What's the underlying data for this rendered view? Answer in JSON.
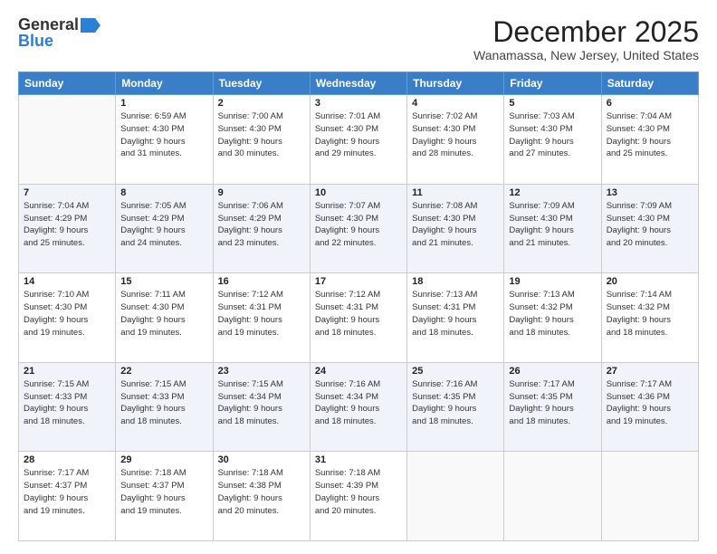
{
  "header": {
    "logo_general": "General",
    "logo_blue": "Blue",
    "title": "December 2025",
    "location": "Wanamassa, New Jersey, United States"
  },
  "days_of_week": [
    "Sunday",
    "Monday",
    "Tuesday",
    "Wednesday",
    "Thursday",
    "Friday",
    "Saturday"
  ],
  "weeks": [
    [
      {
        "day": "",
        "info": ""
      },
      {
        "day": "1",
        "info": "Sunrise: 6:59 AM\nSunset: 4:30 PM\nDaylight: 9 hours\nand 31 minutes."
      },
      {
        "day": "2",
        "info": "Sunrise: 7:00 AM\nSunset: 4:30 PM\nDaylight: 9 hours\nand 30 minutes."
      },
      {
        "day": "3",
        "info": "Sunrise: 7:01 AM\nSunset: 4:30 PM\nDaylight: 9 hours\nand 29 minutes."
      },
      {
        "day": "4",
        "info": "Sunrise: 7:02 AM\nSunset: 4:30 PM\nDaylight: 9 hours\nand 28 minutes."
      },
      {
        "day": "5",
        "info": "Sunrise: 7:03 AM\nSunset: 4:30 PM\nDaylight: 9 hours\nand 27 minutes."
      },
      {
        "day": "6",
        "info": "Sunrise: 7:04 AM\nSunset: 4:30 PM\nDaylight: 9 hours\nand 25 minutes."
      }
    ],
    [
      {
        "day": "7",
        "info": "Sunrise: 7:04 AM\nSunset: 4:29 PM\nDaylight: 9 hours\nand 25 minutes."
      },
      {
        "day": "8",
        "info": "Sunrise: 7:05 AM\nSunset: 4:29 PM\nDaylight: 9 hours\nand 24 minutes."
      },
      {
        "day": "9",
        "info": "Sunrise: 7:06 AM\nSunset: 4:29 PM\nDaylight: 9 hours\nand 23 minutes."
      },
      {
        "day": "10",
        "info": "Sunrise: 7:07 AM\nSunset: 4:30 PM\nDaylight: 9 hours\nand 22 minutes."
      },
      {
        "day": "11",
        "info": "Sunrise: 7:08 AM\nSunset: 4:30 PM\nDaylight: 9 hours\nand 21 minutes."
      },
      {
        "day": "12",
        "info": "Sunrise: 7:09 AM\nSunset: 4:30 PM\nDaylight: 9 hours\nand 21 minutes."
      },
      {
        "day": "13",
        "info": "Sunrise: 7:09 AM\nSunset: 4:30 PM\nDaylight: 9 hours\nand 20 minutes."
      }
    ],
    [
      {
        "day": "14",
        "info": "Sunrise: 7:10 AM\nSunset: 4:30 PM\nDaylight: 9 hours\nand 19 minutes."
      },
      {
        "day": "15",
        "info": "Sunrise: 7:11 AM\nSunset: 4:30 PM\nDaylight: 9 hours\nand 19 minutes."
      },
      {
        "day": "16",
        "info": "Sunrise: 7:12 AM\nSunset: 4:31 PM\nDaylight: 9 hours\nand 19 minutes."
      },
      {
        "day": "17",
        "info": "Sunrise: 7:12 AM\nSunset: 4:31 PM\nDaylight: 9 hours\nand 18 minutes."
      },
      {
        "day": "18",
        "info": "Sunrise: 7:13 AM\nSunset: 4:31 PM\nDaylight: 9 hours\nand 18 minutes."
      },
      {
        "day": "19",
        "info": "Sunrise: 7:13 AM\nSunset: 4:32 PM\nDaylight: 9 hours\nand 18 minutes."
      },
      {
        "day": "20",
        "info": "Sunrise: 7:14 AM\nSunset: 4:32 PM\nDaylight: 9 hours\nand 18 minutes."
      }
    ],
    [
      {
        "day": "21",
        "info": "Sunrise: 7:15 AM\nSunset: 4:33 PM\nDaylight: 9 hours\nand 18 minutes."
      },
      {
        "day": "22",
        "info": "Sunrise: 7:15 AM\nSunset: 4:33 PM\nDaylight: 9 hours\nand 18 minutes."
      },
      {
        "day": "23",
        "info": "Sunrise: 7:15 AM\nSunset: 4:34 PM\nDaylight: 9 hours\nand 18 minutes."
      },
      {
        "day": "24",
        "info": "Sunrise: 7:16 AM\nSunset: 4:34 PM\nDaylight: 9 hours\nand 18 minutes."
      },
      {
        "day": "25",
        "info": "Sunrise: 7:16 AM\nSunset: 4:35 PM\nDaylight: 9 hours\nand 18 minutes."
      },
      {
        "day": "26",
        "info": "Sunrise: 7:17 AM\nSunset: 4:35 PM\nDaylight: 9 hours\nand 18 minutes."
      },
      {
        "day": "27",
        "info": "Sunrise: 7:17 AM\nSunset: 4:36 PM\nDaylight: 9 hours\nand 19 minutes."
      }
    ],
    [
      {
        "day": "28",
        "info": "Sunrise: 7:17 AM\nSunset: 4:37 PM\nDaylight: 9 hours\nand 19 minutes."
      },
      {
        "day": "29",
        "info": "Sunrise: 7:18 AM\nSunset: 4:37 PM\nDaylight: 9 hours\nand 19 minutes."
      },
      {
        "day": "30",
        "info": "Sunrise: 7:18 AM\nSunset: 4:38 PM\nDaylight: 9 hours\nand 20 minutes."
      },
      {
        "day": "31",
        "info": "Sunrise: 7:18 AM\nSunset: 4:39 PM\nDaylight: 9 hours\nand 20 minutes."
      },
      {
        "day": "",
        "info": ""
      },
      {
        "day": "",
        "info": ""
      },
      {
        "day": "",
        "info": ""
      }
    ]
  ]
}
